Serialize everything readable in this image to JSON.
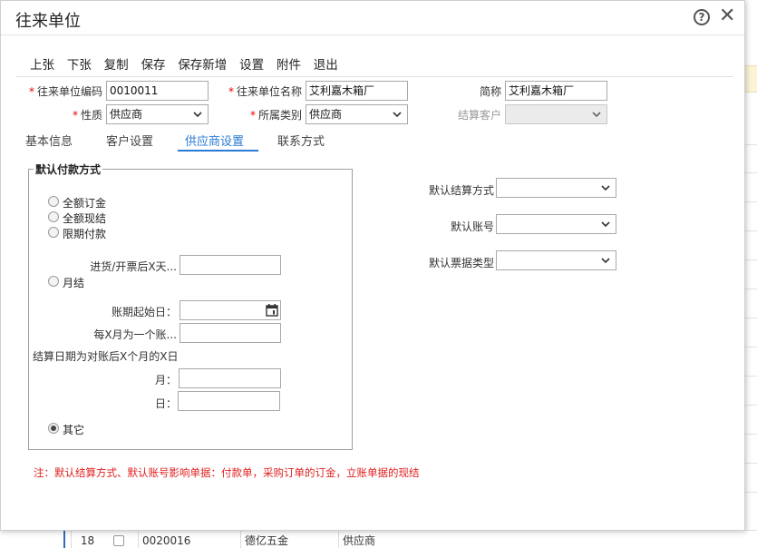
{
  "window": {
    "title": "往来单位"
  },
  "toolbar": [
    "上张",
    "下张",
    "复制",
    "保存",
    "保存新增",
    "设置",
    "附件",
    "退出"
  ],
  "form": {
    "code_label": "往来单位编码",
    "code_value": "0010011",
    "name_label": "往来单位名称",
    "name_value": "艾利嘉木箱厂",
    "short_label": "简称",
    "short_value": "艾利嘉木箱厂",
    "nature_label": "性质",
    "nature_value": "供应商",
    "category_label": "所属类别",
    "category_value": "供应商",
    "settle_customer_label": "结算客户",
    "settle_customer_value": ""
  },
  "tabs": [
    "基本信息",
    "客户设置",
    "供应商设置",
    "联系方式"
  ],
  "active_tab": "供应商设置",
  "payment": {
    "legend": "默认付款方式",
    "options": [
      "全额订金",
      "全额现结",
      "限期付款"
    ],
    "days_after_label": "进货/开票后X天...",
    "monthly_label": "月结",
    "period_start_label": "账期起始日：",
    "every_x_month_label": "每X月为一个账...",
    "settle_date_label": "结算日期为对账后X个月的X日",
    "month_label": "月：",
    "day_label": "日：",
    "other_label": "其它",
    "selected": "其它"
  },
  "defaults": {
    "settle_method_label": "默认结算方式",
    "account_label": "默认账号",
    "invoice_type_label": "默认票据类型"
  },
  "note": "注：默认结算方式、默认账号影响单据：付款单，采购订单的订金，立账单据的现结",
  "background_row": {
    "index": "18",
    "code": "0020016",
    "name": "德亿五金",
    "type": "供应商"
  },
  "colors": {
    "accent": "#2b7bd6",
    "required": "#e60000",
    "note": "#e02020"
  }
}
